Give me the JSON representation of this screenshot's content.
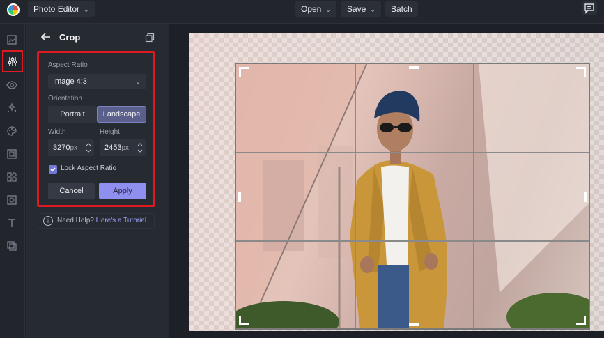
{
  "topbar": {
    "app_menu_label": "Photo Editor",
    "open_label": "Open",
    "save_label": "Save",
    "batch_label": "Batch"
  },
  "rail": {
    "items": [
      "layers-icon",
      "adjust-icon",
      "eye-icon",
      "effects-icon",
      "palette-icon",
      "frame-icon",
      "shapes-icon",
      "texture-icon",
      "text-icon",
      "overlay-icon"
    ],
    "active": "adjust-icon"
  },
  "panel": {
    "title": "Crop",
    "aspect_ratio_label": "Aspect Ratio",
    "aspect_ratio_value": "Image 4:3",
    "orientation_label": "Orientation",
    "orientation_options": [
      "Portrait",
      "Landscape"
    ],
    "orientation_selected": "Landscape",
    "width_label": "Width",
    "height_label": "Height",
    "width_value": "3270",
    "height_value": "2453",
    "unit": "px",
    "lock_label": "Lock Aspect Ratio",
    "lock_checked": true,
    "cancel_label": "Cancel",
    "apply_label": "Apply",
    "help_text": "Need Help?",
    "help_link": "Here's a Tutorial"
  },
  "colors": {
    "accent": "#8f8ff0",
    "highlight": "#e01a22",
    "background": "#1f2229"
  }
}
